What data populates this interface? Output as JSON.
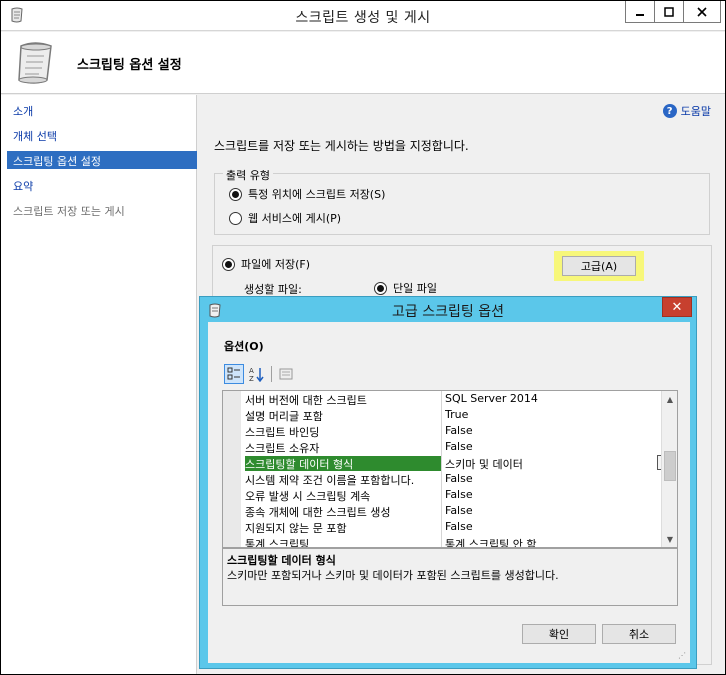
{
  "window": {
    "title": "스크립트 생성 및 게시"
  },
  "header": {
    "title": "스크립팅 옵션 설정"
  },
  "nav": {
    "items": [
      {
        "label": "소개"
      },
      {
        "label": "개체 선택"
      },
      {
        "label": "스크립팅 옵션 설정"
      },
      {
        "label": "요약"
      },
      {
        "label": "스크립트 저장 또는 게시"
      }
    ]
  },
  "content": {
    "help": "도움말",
    "instruction": "스크립트를 저장 또는 게시하는 방법을 지정합니다.",
    "output_type": {
      "legend": "출력 유형",
      "option_save": "특정 위치에 스크립트 저장(S)",
      "option_web": "웹 서비스에 게시(P)"
    },
    "save_to_file": "파일에 저장(F)",
    "advanced_button": "고급(A)",
    "files_label": "생성할 파일:",
    "single_file": "단일 파일"
  },
  "dialog": {
    "title": "고급 스크립팅 옵션",
    "options_label": "옵션(O)",
    "rows": [
      {
        "name": "서버 버전에 대한 스크립트",
        "value": "SQL Server 2014"
      },
      {
        "name": "설명 머리글 포함",
        "value": "True"
      },
      {
        "name": "스크립트 바인딩",
        "value": "False"
      },
      {
        "name": "스크립트 소유자",
        "value": "False"
      },
      {
        "name": "스크립팅할 데이터 형식",
        "value": "스키마 및 데이터"
      },
      {
        "name": "시스템 제약 조건 이름을 포함합니다.",
        "value": "False"
      },
      {
        "name": "오류 발생 시 스크립팅 계속",
        "value": "False"
      },
      {
        "name": "종속 개체에 대한 스크립트 생성",
        "value": "False"
      },
      {
        "name": "지원되지 않는 문 포함",
        "value": "False"
      },
      {
        "name": "통계 스크립팅",
        "value": "통계 스크립팅 안 함"
      }
    ],
    "description_title": "스크립팅할 데이터 형식",
    "description_text": "스키마만 포함되거나 스키마 및 데이터가 포함된 스크립트를 생성합니다.",
    "ok": "확인",
    "cancel": "취소"
  },
  "colors": {
    "dialog_frame": "#5bc7ea",
    "selection_blue": "#2e6ec1",
    "selected_row": "#2e8b2e",
    "highlight": "#f7f77a",
    "close_red": "#c7402f"
  }
}
